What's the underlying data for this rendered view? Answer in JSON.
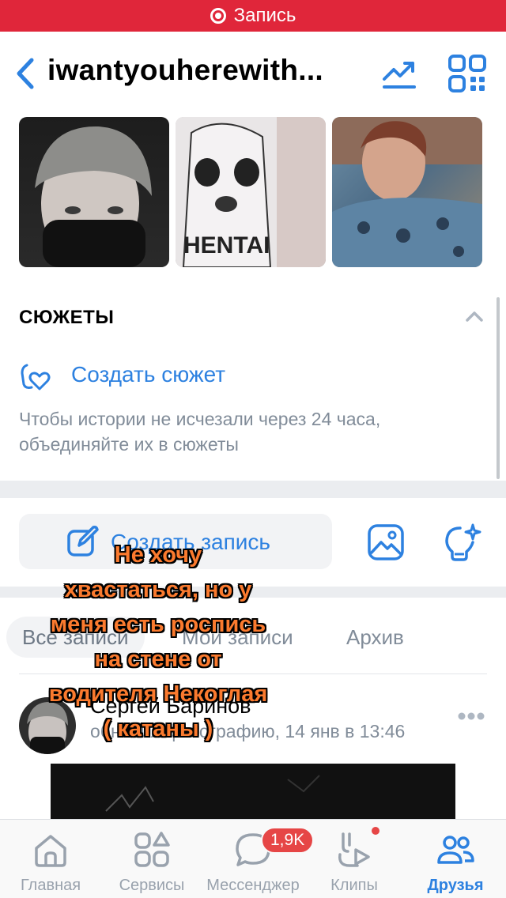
{
  "recording": {
    "label": "Запись"
  },
  "header": {
    "title": "iwantyouherewith..."
  },
  "photos": [
    {
      "name": "photo-1"
    },
    {
      "name": "photo-2",
      "overlay_text": "HENTAI"
    },
    {
      "name": "photo-3"
    }
  ],
  "stories": {
    "title": "СЮЖЕТЫ",
    "create_label": "Создать сюжет",
    "hint": "Чтобы истории не исчезали через 24 часа, объединяйте их в сюжеты"
  },
  "composer": {
    "create_post_label": "Создать запись"
  },
  "filters": {
    "all": "Все записи",
    "mine": "Мои записи",
    "archive": "Архив"
  },
  "post": {
    "author": "Сергей Баринов",
    "meta": "обновил фотографию, 14 янв в 13:46"
  },
  "caption": {
    "lines": [
      "Не хочу",
      "хвастаться, но у",
      "меня есть роспись",
      "на стене от",
      "водителя Некоглая",
      "( катаны )"
    ]
  },
  "tabs": {
    "home": "Главная",
    "services": "Сервисы",
    "messenger": "Мессенджер",
    "clips": "Клипы",
    "friends": "Друзья",
    "messenger_badge": "1,9K"
  },
  "colors": {
    "accent": "#2d81e0",
    "record": "#e0263a",
    "badge": "#e64646",
    "caption": "#fb7a2e"
  }
}
